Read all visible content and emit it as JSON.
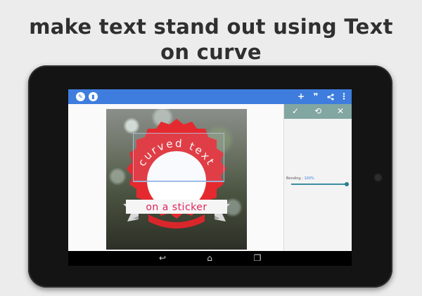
{
  "headline": {
    "line1": "make text stand out using Text",
    "line2": "on curve"
  },
  "actionbar": {
    "left_icons": [
      "pencil-icon",
      "trash-icon"
    ],
    "right_icons": [
      "add-icon",
      "quote-icon",
      "share-icon",
      "more-vert-icon"
    ],
    "color": "#3e7ddd"
  },
  "sticker": {
    "curved_text": "curved text",
    "ribbon_text": "on a sticker",
    "badge_color": "#e42a2f",
    "text_color": "#e0245e"
  },
  "panel": {
    "head_icons": [
      "check-icon",
      "reset-icon",
      "close-icon"
    ],
    "head_color": "#82a6a2",
    "bending_label": "Bending : ",
    "bending_value": "100%",
    "bending_level": 1.0
  },
  "navbar": {
    "icons": [
      "back-icon",
      "home-icon",
      "recents-icon"
    ]
  }
}
